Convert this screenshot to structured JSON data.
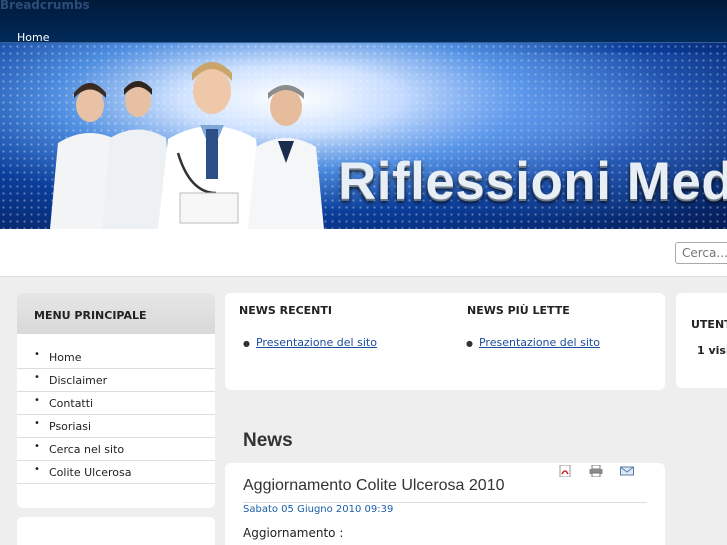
{
  "breadcrumbs": {
    "heading": "Breadcrumbs",
    "items": [
      "Home"
    ]
  },
  "banner": {
    "title": "Riflessioni Med"
  },
  "search": {
    "placeholder": "Cerca..."
  },
  "menu": {
    "title": "MENU PRINCIPALE",
    "items": [
      {
        "label": "Home"
      },
      {
        "label": "Disclaimer"
      },
      {
        "label": "Contatti"
      },
      {
        "label": "Psoriasi"
      },
      {
        "label": "Cerca nel sito"
      },
      {
        "label": "Colite Ulcerosa"
      }
    ]
  },
  "news_recent": {
    "title": "NEWS RECENTI",
    "link": "Presentazione del sito"
  },
  "news_popular": {
    "title": "NEWS PIÙ LETTE",
    "link": "Presentazione del sito"
  },
  "users": {
    "title": "UTENT",
    "count": "1 visi"
  },
  "section": {
    "title": "News"
  },
  "article": {
    "title": "Aggiornamento Colite Ulcerosa 2010",
    "date": "Sabato 05 Giugno 2010 09:39",
    "body": "Aggiornamento :",
    "icons": [
      "pdf-icon",
      "print-icon",
      "email-icon"
    ]
  },
  "colors": {
    "topbar": "#001a3a",
    "link": "#1a4c9c",
    "page_bg": "#eeeeee"
  }
}
